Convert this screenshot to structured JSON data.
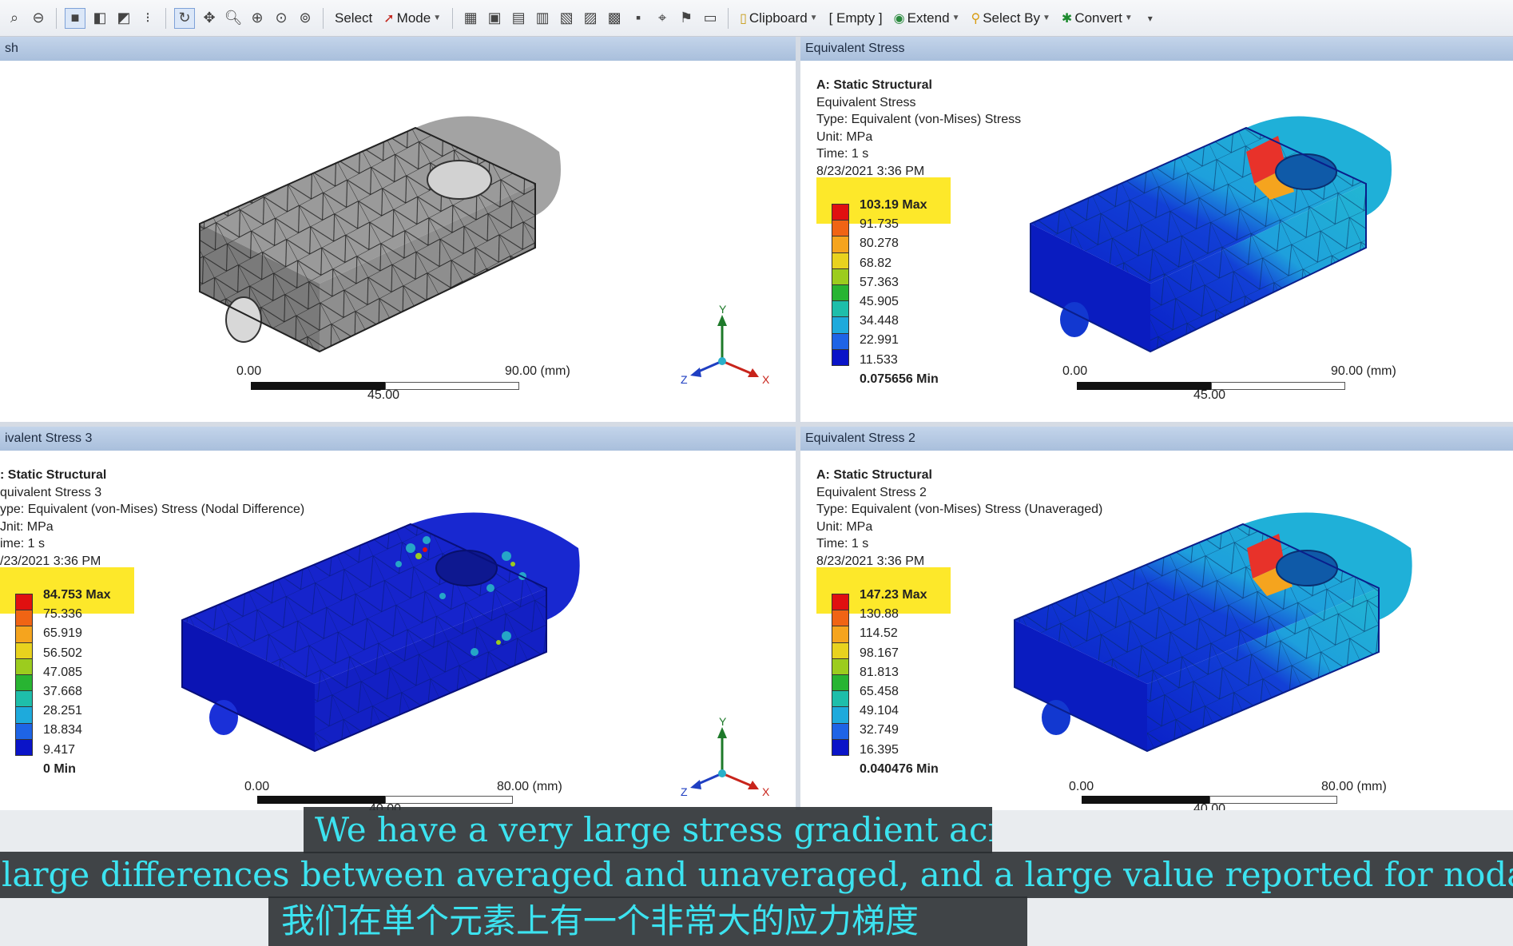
{
  "toolbar": {
    "select_label": "Select",
    "mode_label": "Mode",
    "clipboard_label": "Clipboard",
    "empty_label": "[ Empty ]",
    "extend_label": "Extend",
    "select_by_label": "Select By",
    "convert_label": "Convert"
  },
  "panels": {
    "mesh": {
      "header": "sh",
      "scale_left": "0.00",
      "scale_mid": "45.00",
      "scale_right": "90.00 (mm)"
    },
    "eq1": {
      "header": "Equivalent Stress",
      "title": "A: Static Structural",
      "lines": [
        "Equivalent Stress",
        "Type: Equivalent (von-Mises) Stress",
        "Unit: MPa",
        "Time: 1 s",
        "8/23/2021 3:36 PM"
      ],
      "legend": [
        "103.19 Max",
        "91.735",
        "80.278",
        "68.82",
        "57.363",
        "45.905",
        "34.448",
        "22.991",
        "11.533",
        "0.075656 Min"
      ],
      "scale_left": "0.00",
      "scale_mid": "45.00",
      "scale_right": "90.00 (mm)"
    },
    "eq3": {
      "header": "ivalent Stress 3",
      "title": ": Static Structural",
      "lines": [
        "quivalent Stress 3",
        "ype: Equivalent (von-Mises) Stress (Nodal Difference)",
        "Jnit: MPa",
        "ime: 1 s",
        "/23/2021 3:36 PM"
      ],
      "legend": [
        "84.753 Max",
        "75.336",
        "65.919",
        "56.502",
        "47.085",
        "37.668",
        "28.251",
        "18.834",
        "9.417",
        "0 Min"
      ],
      "scale_left": "0.00",
      "scale_mid": "40.00",
      "scale_right": "80.00 (mm)"
    },
    "eq2": {
      "header": "Equivalent Stress 2",
      "title": "A: Static Structural",
      "lines": [
        "Equivalent Stress 2",
        "Type: Equivalent (von-Mises) Stress (Unaveraged)",
        "Unit: MPa",
        "Time: 1 s",
        "8/23/2021 3:36 PM"
      ],
      "legend": [
        "147.23 Max",
        "130.88",
        "114.52",
        "98.167",
        "81.813",
        "65.458",
        "49.104",
        "32.749",
        "16.395",
        "0.040476 Min"
      ],
      "scale_left": "0.00",
      "scale_mid": "40.00",
      "scale_right": "80.00 (mm)"
    }
  },
  "triad": {
    "x": "X",
    "y": "Y",
    "z": "Z"
  },
  "subtitles": {
    "line1": "We have a very large stress gradient across",
    "line2": "large differences between averaged and unaveraged, and a large value reported for nodal differences",
    "line3": "我们在单个元素上有一个非常大的应力梯度"
  },
  "colors": {
    "legend": [
      "#e01010",
      "#f06414",
      "#f5a41e",
      "#e8d21e",
      "#9ccc1e",
      "#28b432",
      "#1ebeaa",
      "#1eaadc",
      "#1e64e6",
      "#0a14c8"
    ],
    "highlight": "#fde82a",
    "subtitle_text": "#3ce3f0"
  }
}
